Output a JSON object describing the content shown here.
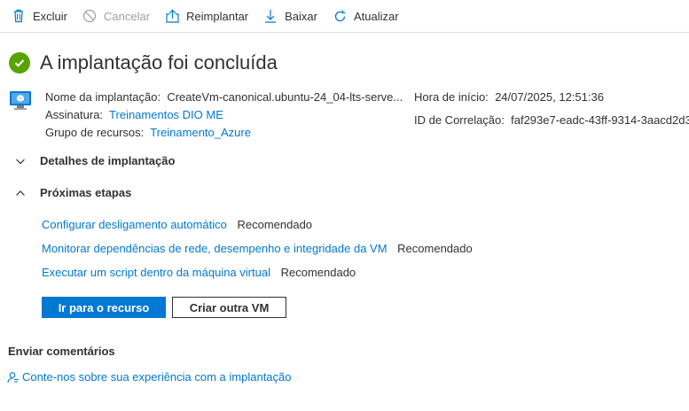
{
  "toolbar": {
    "delete": "Excluir",
    "cancel": "Cancelar",
    "redeploy": "Reimplantar",
    "download": "Baixar",
    "refresh": "Atualizar"
  },
  "header": {
    "title": "A implantação foi concluída",
    "status_icon": "success-check-icon",
    "status_color": "#57a300"
  },
  "info": {
    "deployment_name_label": "Nome da implantação:",
    "deployment_name": "CreateVm-canonical.ubuntu-24_04-lts-serve...",
    "subscription_label": "Assinatura:",
    "subscription": "Treinamentos DIO ME",
    "resource_group_label": "Grupo de recursos:",
    "resource_group": "Treinamento_Azure",
    "start_time_label": "Hora de início:",
    "start_time": "24/07/2025, 12:51:36",
    "correlation_label": "ID de Correlação:",
    "correlation_id": "faf293e7-eadc-43ff-9314-3aacd2d3"
  },
  "sections": {
    "details": "Detalhes de implantação",
    "next_steps": "Próximas etapas"
  },
  "next_steps": [
    {
      "label": "Configurar desligamento automático",
      "tag": "Recomendado"
    },
    {
      "label": "Monitorar dependências de rede, desempenho e integridade da VM",
      "tag": "Recomendado"
    },
    {
      "label": "Executar um script dentro da máquina virtual",
      "tag": "Recomendado"
    }
  ],
  "actions": {
    "go_to_resource": "Ir para o recurso",
    "create_another": "Criar outra VM"
  },
  "feedback": {
    "title": "Enviar comentários",
    "link": "Conte-nos sobre sua experiência com a implantação"
  },
  "colors": {
    "accent": "#0078d4",
    "success": "#57a300"
  }
}
